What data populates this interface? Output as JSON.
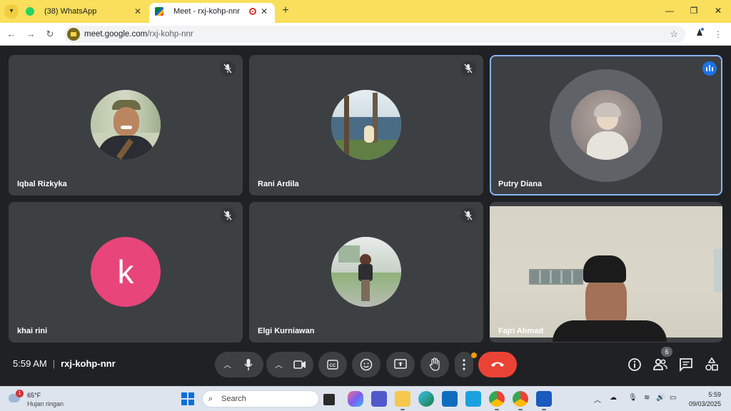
{
  "browser": {
    "tabs": [
      {
        "title": "(38) WhatsApp",
        "icon": "whatsapp-icon",
        "active": false
      },
      {
        "title": "Meet - rxj-kohp-nnr",
        "icon": "google-meet-icon",
        "active": true
      }
    ],
    "url_domain": "meet.google.com",
    "url_path": "/rxj-kohp-nnr"
  },
  "participants": [
    {
      "name": "Iqbal Rizkyka",
      "muted": true,
      "avatar": "photo"
    },
    {
      "name": "Rani Ardila",
      "muted": true,
      "avatar": "photo"
    },
    {
      "name": "Putry Diana",
      "muted": false,
      "speaking": true,
      "avatar": "photo"
    },
    {
      "name": "khai rini",
      "muted": true,
      "avatar": "letter",
      "letter": "k",
      "avatar_color": "#e8457a"
    },
    {
      "name": "Elgi Kurniawan",
      "muted": true,
      "avatar": "photo"
    },
    {
      "name": "Fajri Ahmad",
      "muted": false,
      "avatar": "camera"
    }
  ],
  "meeting": {
    "time": "5:59 AM",
    "separator": "|",
    "code": "rxj-kohp-nnr",
    "participant_count": "6"
  },
  "taskbar": {
    "weather_badge": "1",
    "temperature": "65°F",
    "condition": "Hujan ringan",
    "search_placeholder": "Search",
    "clock_time": "5:59",
    "clock_date": "09/03/2025"
  },
  "colors": {
    "tab_bar": "#f9df5b",
    "meet_background": "#202124",
    "tile_background": "#3c4043",
    "speaking_outline": "#8ab4f8",
    "end_call": "#ea4335"
  }
}
